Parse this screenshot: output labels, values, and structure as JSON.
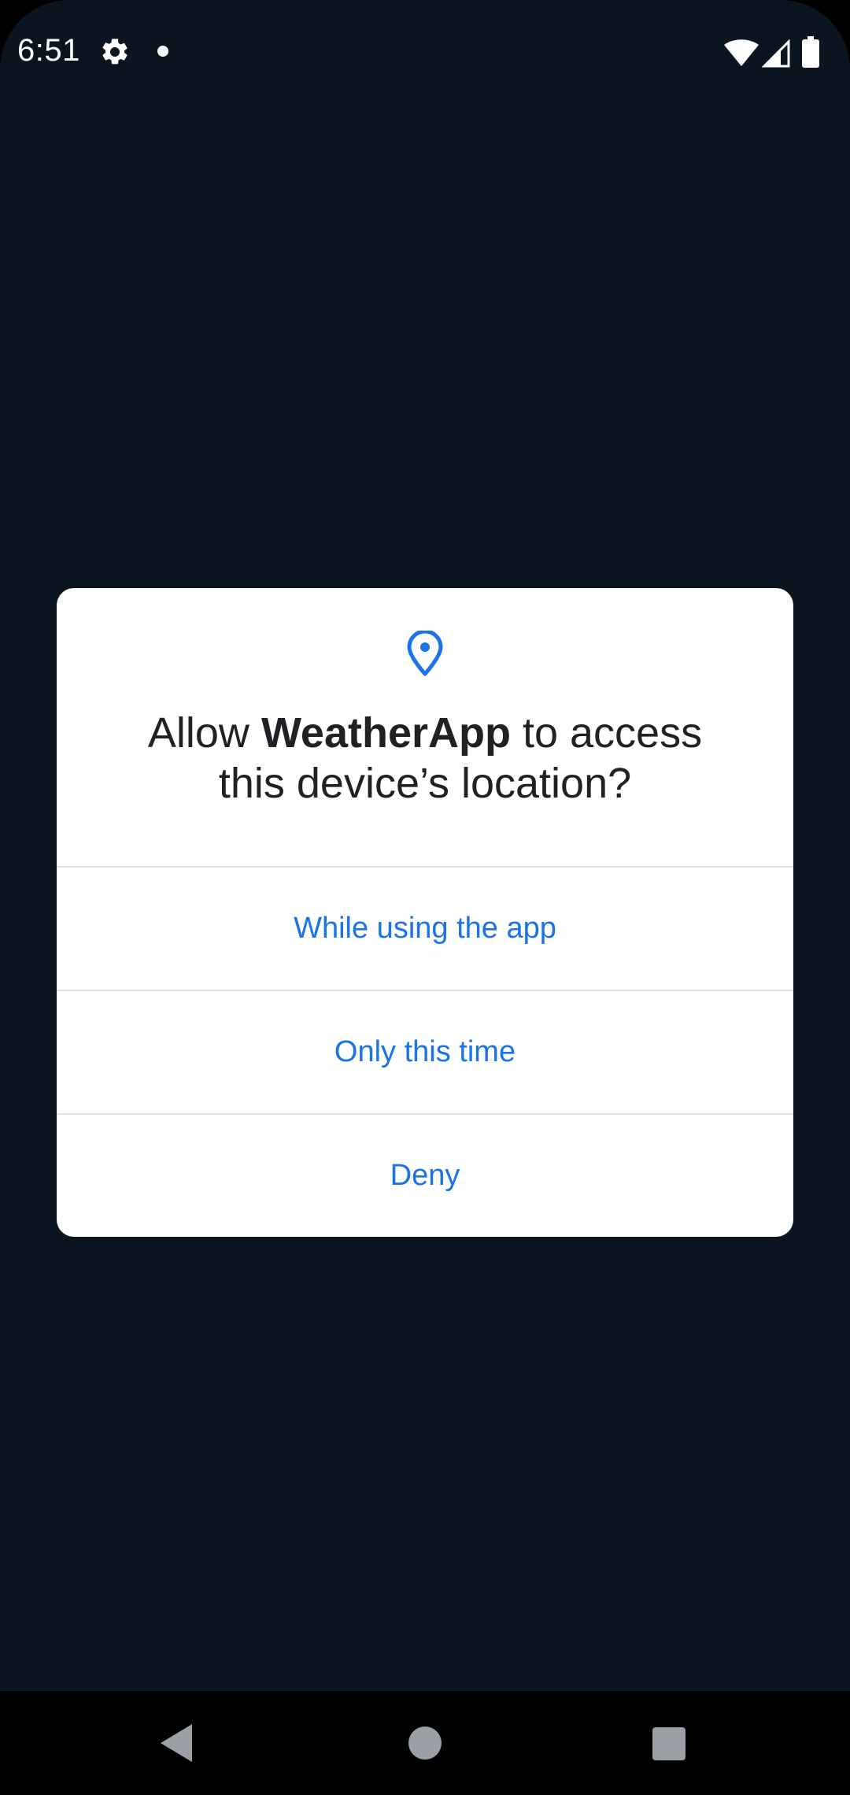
{
  "status_bar": {
    "time": "6:51"
  },
  "permission_dialog": {
    "title_prefix": "Allow ",
    "app_name": "WeatherApp",
    "title_suffix_line1": " to access",
    "title_line2": "this device’s location?",
    "options": [
      {
        "label": "While using the app"
      },
      {
        "label": "Only this time"
      },
      {
        "label": "Deny"
      }
    ]
  },
  "colors": {
    "background": "#0b1520",
    "dialog": "#ffffff",
    "accent": "#1a73e8",
    "title_text": "#202124",
    "nav_bar": "#000000"
  },
  "icons": {
    "status": [
      "gear-icon",
      "notification-dot-icon",
      "wifi-icon",
      "cell-signal-icon",
      "battery-icon"
    ],
    "dialog": "location-pin-icon",
    "nav": [
      "back-icon",
      "home-icon",
      "recents-icon"
    ]
  }
}
